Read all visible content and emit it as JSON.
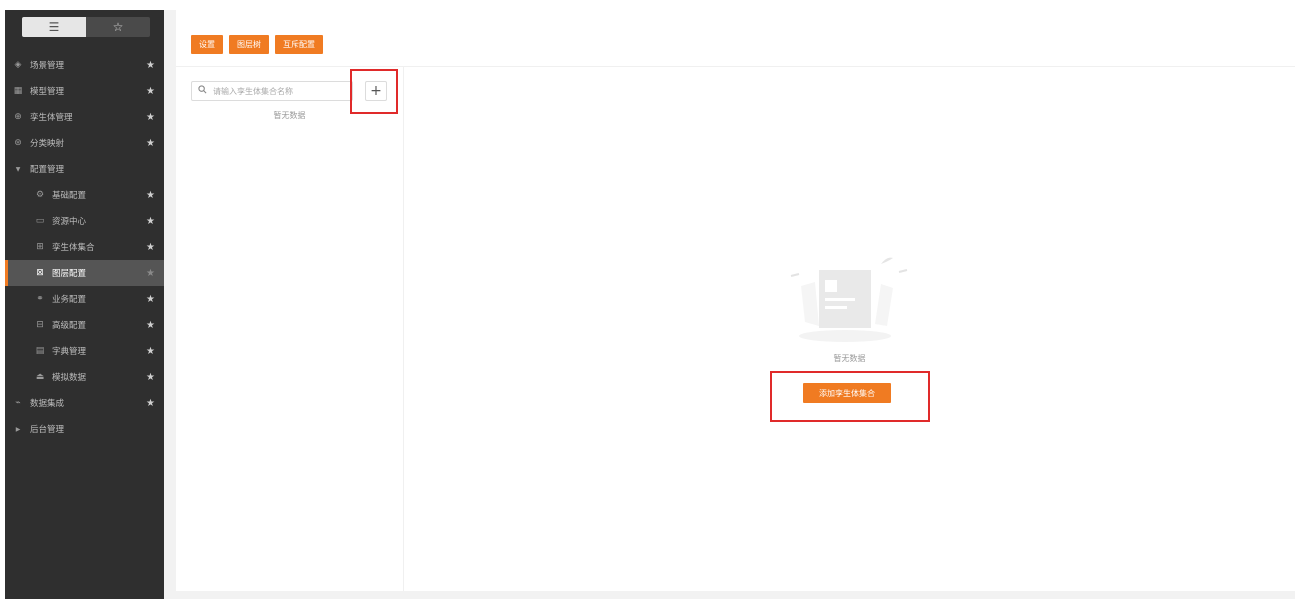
{
  "sidebar": {
    "tabs": [
      {
        "icon": "list-icon",
        "glyph": "☰"
      },
      {
        "icon": "star-outline-icon",
        "glyph": "☆"
      }
    ],
    "items": [
      {
        "label": "场景管理",
        "icon": "layers-icon",
        "glyph": "◈",
        "starred": true
      },
      {
        "label": "模型管理",
        "icon": "model-icon",
        "glyph": "▦",
        "starred": true
      },
      {
        "label": "孪生体管理",
        "icon": "globe-icon",
        "glyph": "⊕",
        "starred": true
      },
      {
        "label": "分类映射",
        "icon": "mapping-icon",
        "glyph": "⊛",
        "starred": true
      },
      {
        "label": "配置管理",
        "icon": "caret-down-icon",
        "glyph": "▼",
        "group": true,
        "expanded": true
      },
      {
        "label": "基础配置",
        "icon": "settings-icon",
        "glyph": "⚙",
        "starred": true,
        "sub": true
      },
      {
        "label": "资源中心",
        "icon": "folder-icon",
        "glyph": "▭",
        "starred": true,
        "sub": true
      },
      {
        "label": "孪生体集合",
        "icon": "collection-icon",
        "glyph": "⊞",
        "starred": true,
        "sub": true
      },
      {
        "label": "图层配置",
        "icon": "layer-config-icon",
        "glyph": "⊠",
        "starred": true,
        "sub": true,
        "active": true
      },
      {
        "label": "业务配置",
        "icon": "business-icon",
        "glyph": "⚭",
        "starred": true,
        "sub": true
      },
      {
        "label": "高级配置",
        "icon": "advanced-icon",
        "glyph": "⊟",
        "starred": true,
        "sub": true
      },
      {
        "label": "字典管理",
        "icon": "dictionary-icon",
        "glyph": "▤",
        "starred": true,
        "sub": true
      },
      {
        "label": "模拟数据",
        "icon": "mock-data-icon",
        "glyph": "⏏",
        "starred": true,
        "sub": true
      },
      {
        "label": "数据集成",
        "icon": "chart-line-icon",
        "glyph": "⌁",
        "starred": true
      },
      {
        "label": "后台管理",
        "icon": "caret-right-icon",
        "glyph": "▶",
        "group": true,
        "expanded": false
      }
    ]
  },
  "toolbar": {
    "buttons": [
      "设置",
      "图层树",
      "互斥配置"
    ]
  },
  "left_panel": {
    "search_placeholder": "请输入孪生体集合名称",
    "add_glyph": "+",
    "empty_text": "暂无数据"
  },
  "main_panel": {
    "empty_text": "暂无数据",
    "add_button_label": "添加孪生体集合"
  },
  "colors": {
    "accent": "#f07b22",
    "sidebar_bg": "#2f2f2f",
    "highlight_box": "#e02a2a"
  }
}
